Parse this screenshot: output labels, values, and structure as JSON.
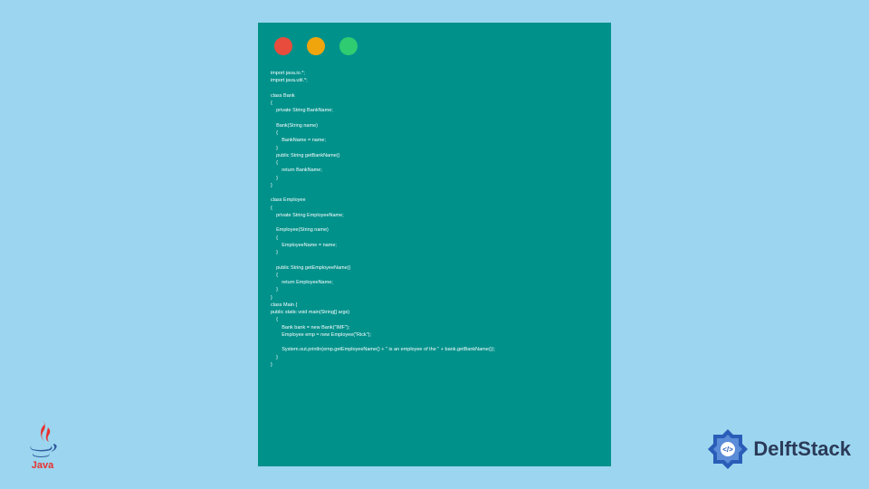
{
  "window": {
    "traffic_lights": {
      "red": "#e84c3d",
      "yellow": "#f1a50d",
      "green": "#2fcc71"
    }
  },
  "code": {
    "content": "import java.io.*;\nimport java.util.*;\n\nclass Bank\n{\n    private String BankName;\n\n    Bank(String name)\n    {\n        BankName = name;\n    }\n    public String getBankName()\n    {\n        return BankName;\n    }\n}\n\nclass Employee\n{\n    private String EmployeeName;\n\n    Employee(String name)\n    {\n        EmployeeName = name;\n    }\n\n    public String getEmployeeName()\n    {\n        return EmployeeName;\n    }\n}\nclass Main {\npublic static void main(String[] args)\n    {\n        Bank bank = new Bank(\"IMF\");\n        Employee emp = new Employee(\"Rick\");\n\n        System.out.println(emp.getEmployeeName() + \" is an employee of the \" + bank.getBankName());\n    }\n}"
  },
  "logos": {
    "java_label": "Java",
    "delft_label": "DelftStack"
  },
  "colors": {
    "background": "#9bd5ef",
    "window_bg": "#00918b",
    "code_text": "#ffffff",
    "java_red": "#e8302e",
    "java_blue": "#2e5a9e",
    "delft_blue": "#2a5db8",
    "delft_light": "#5a8cd8",
    "delft_text": "#2b3a59"
  }
}
